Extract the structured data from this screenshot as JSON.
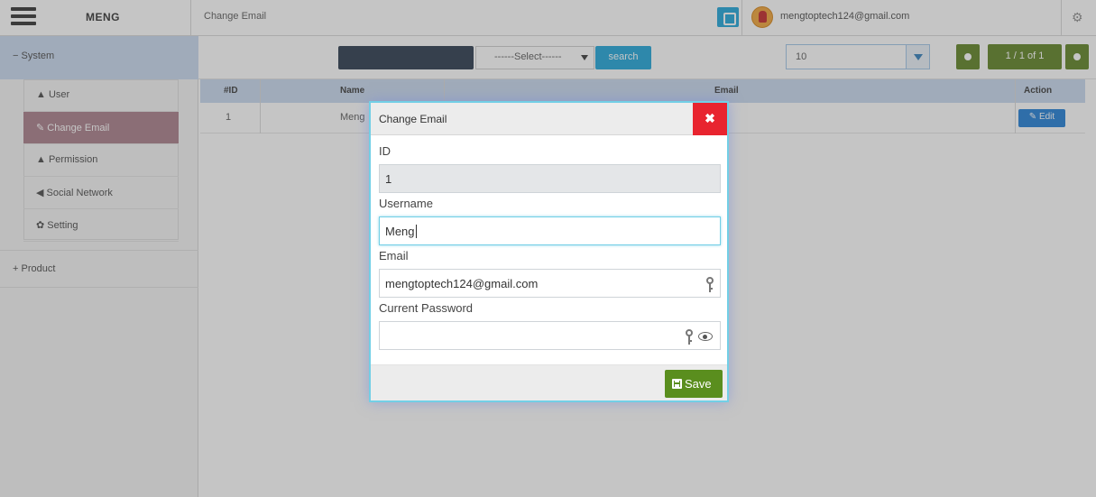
{
  "app": {
    "brand": "MENG",
    "page_title": "Change Email",
    "user_email": "mengtoptech124@gmail.com"
  },
  "sidebar": {
    "section_system": "− System",
    "items": [
      {
        "label": "▲ User",
        "active": false
      },
      {
        "label": "✎ Change Email",
        "active": true
      },
      {
        "label": "▲ Permission",
        "active": false
      },
      {
        "label": "◀ Social Network",
        "active": false
      },
      {
        "label": "✿ Setting",
        "active": false
      }
    ],
    "section_product": "+ Product"
  },
  "toolbar": {
    "select_placeholder": "------Select------",
    "search_label": "search",
    "page_size": "10",
    "pager": "1 / 1 of 1"
  },
  "grid": {
    "headers": [
      "#ID",
      "Name",
      "Email",
      "Action"
    ],
    "rows": [
      {
        "id": "1",
        "name": "Meng",
        "action": "✎ Edit"
      }
    ]
  },
  "modal": {
    "title": "Change Email",
    "close_label": "✖",
    "id_label": "ID",
    "id_value": "1",
    "username_label": "Username",
    "username_value": "Meng",
    "email_label": "Email",
    "email_value": "mengtoptech124@gmail.com",
    "password_label": "Current Password",
    "password_value": "",
    "save_label": "Save"
  },
  "colors": {
    "close_button": "#e8242f",
    "save_button": "#5a8e1e",
    "modal_border": "#72cfe6",
    "sidebar_active": "#a77a86",
    "header_band": "#c7d8ef"
  },
  "icons": {
    "menu": "hamburger-icon",
    "email_key": "key-icon",
    "password_key": "key-icon",
    "password_toggle": "eye-icon",
    "save": "floppy-disk-icon"
  }
}
